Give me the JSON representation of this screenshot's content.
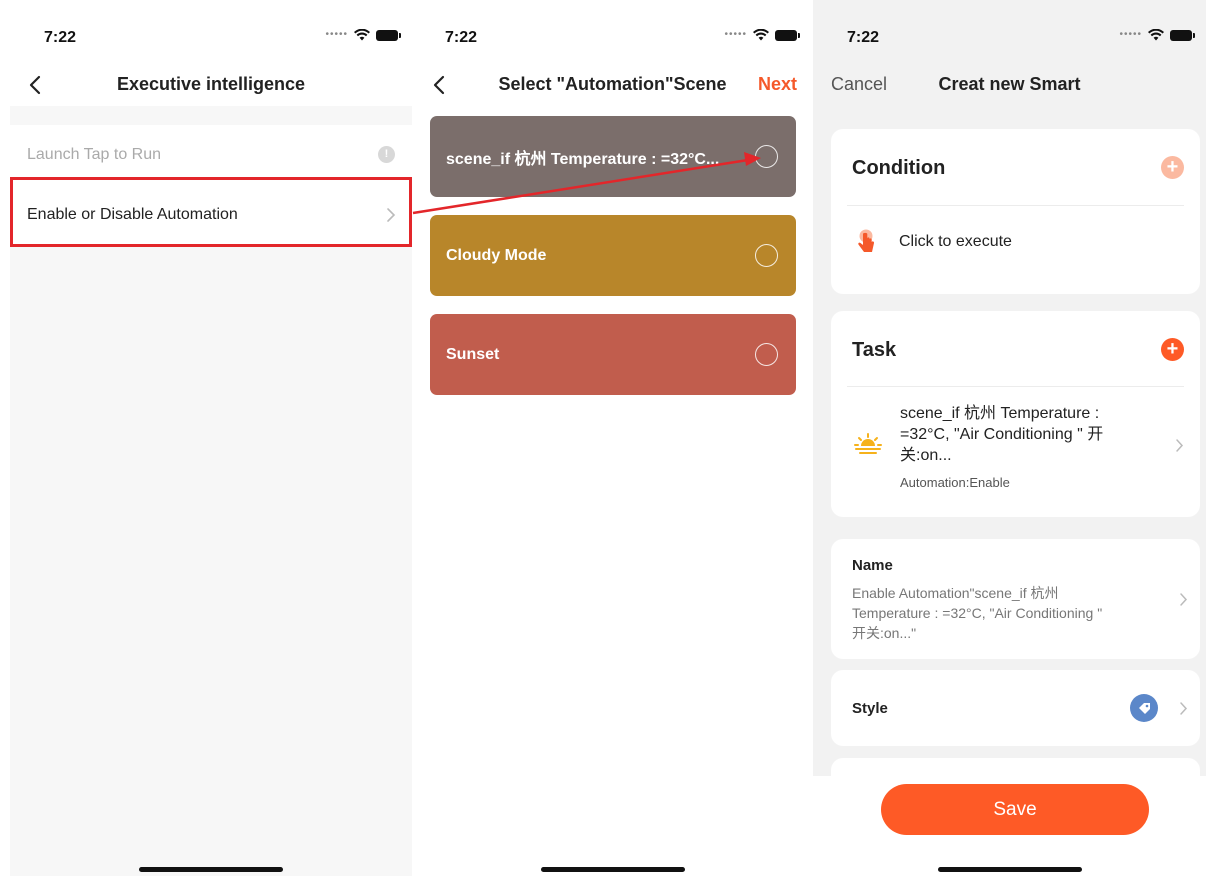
{
  "screen1": {
    "time": "7:22",
    "title": "Executive intelligence",
    "items": [
      {
        "label": "Launch Tap to Run",
        "info_icon": "!"
      },
      {
        "label": "Enable or Disable Automation"
      }
    ]
  },
  "screen2": {
    "time": "7:22",
    "title": "Select \"Automation\"Scene",
    "next_label": "Next",
    "scenes": [
      {
        "label": "scene_if 杭州 Temperature : =32°C...",
        "color": "#7b6e6b"
      },
      {
        "label": "Cloudy Mode",
        "color": "#b8862a"
      },
      {
        "label": "Sunset",
        "color": "#c15d4d"
      }
    ]
  },
  "screen3": {
    "time": "7:22",
    "cancel_label": "Cancel",
    "title": "Creat new Smart",
    "condition": {
      "title": "Condition",
      "plus": "+",
      "item": "Click to execute",
      "item_icon": "tap-hand-icon"
    },
    "task": {
      "title": "Task",
      "plus": "+",
      "item_icon": "sunrise-icon",
      "item_line1": "scene_if 杭州 Temperature :",
      "item_line2": "=32°C, \"Air Conditioning \" 开",
      "item_line3": "关:on...",
      "item_sub": "Automation:Enable"
    },
    "name": {
      "label": "Name",
      "line1": " Enable Automation\"scene_if 杭州",
      "line2": "Temperature : =32°C, \"Air Conditioning \"",
      "line3": "开关:on...\""
    },
    "style": {
      "label": "Style",
      "icon": "tag-icon"
    },
    "save_label": "Save"
  },
  "colors": {
    "accent": "#fe5a26",
    "highlight": "#e3262a",
    "style_icon": "#5b87c9"
  }
}
